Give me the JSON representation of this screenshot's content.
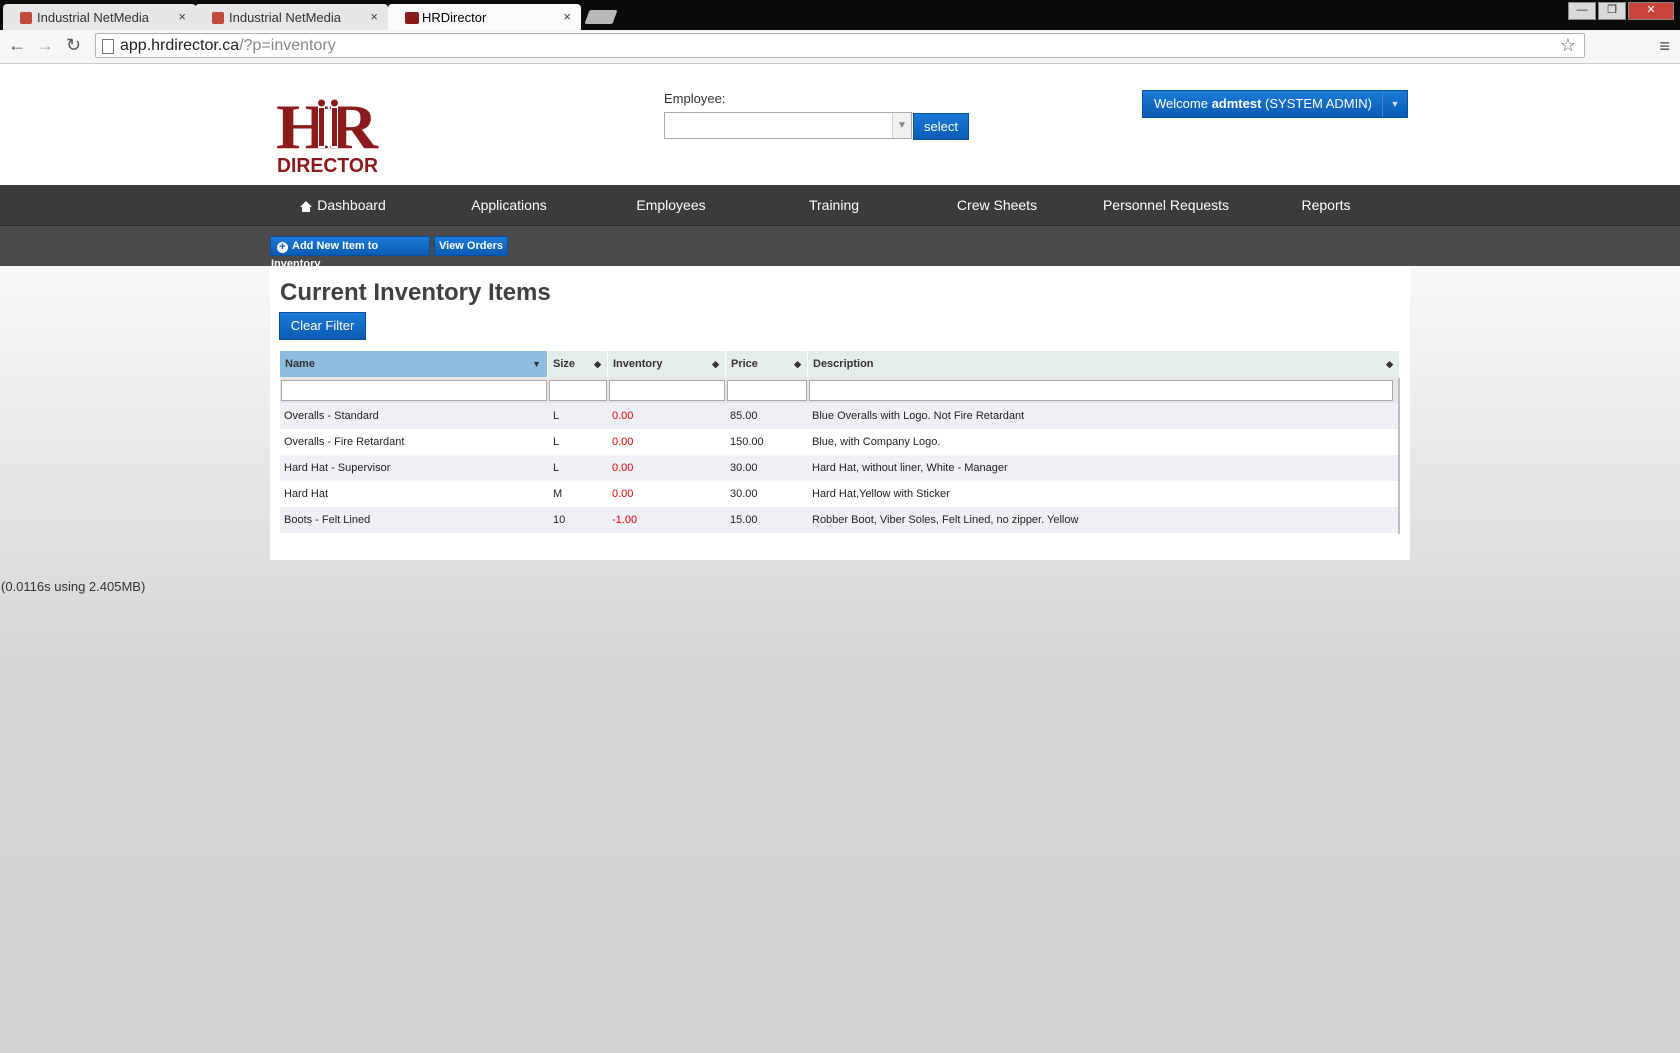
{
  "browser": {
    "tabs": [
      {
        "title": "Industrial NetMedia",
        "active": false
      },
      {
        "title": "Industrial NetMedia",
        "active": false
      },
      {
        "title": "HRDirector",
        "active": true
      }
    ],
    "close_glyph": "×",
    "url_host": "app.hrdirector.ca",
    "url_path": "/?p=inventory",
    "window_controls": [
      "—",
      "❐",
      "✕"
    ]
  },
  "header": {
    "logo_text_top": "HR",
    "logo_text_bottom": "DIRECTOR",
    "employee_label": "Employee:",
    "employee_value": "",
    "select_label": "select",
    "welcome_prefix": "Welcome ",
    "welcome_user": "admtest",
    "welcome_role": " (SYSTEM ADMIN)"
  },
  "nav": {
    "items": [
      "Dashboard",
      "Applications",
      "Employees",
      "Training",
      "Crew Sheets",
      "Personnel Requests",
      "Reports"
    ]
  },
  "subnav": {
    "add_label": "Add New Item to Inventory",
    "orders_label": "View Orders"
  },
  "main": {
    "title": "Current Inventory Items",
    "clear_filter_label": "Clear Filter",
    "columns": [
      "Name",
      "Size",
      "Inventory",
      "Price",
      "Description"
    ],
    "rows": [
      {
        "name": "Overalls - Standard",
        "size": "L",
        "inventory": "0.00",
        "price": "85.00",
        "description": "Blue Overalls with Logo. Not Fire Retardant"
      },
      {
        "name": "Overalls - Fire Retardant",
        "size": "L",
        "inventory": "0.00",
        "price": "150.00",
        "description": "Blue, with Company Logo."
      },
      {
        "name": "Hard Hat - Supervisor",
        "size": "L",
        "inventory": "0.00",
        "price": "30.00",
        "description": "Hard Hat, without liner, White - Manager"
      },
      {
        "name": "Hard Hat",
        "size": "M",
        "inventory": "0.00",
        "price": "30.00",
        "description": "Hard Hat,Yellow with Sticker"
      },
      {
        "name": "Boots - Felt Lined",
        "size": "10",
        "inventory": "-1.00",
        "price": "15.00",
        "description": "Robber Boot, Viber Soles, Felt Lined, no zipper. Yellow"
      }
    ]
  },
  "footer": {
    "stat": "(0.0116s using 2.405MB)"
  },
  "colors": {
    "brand_red": "#8b1a1a",
    "primary_blue": "#0a5bb3",
    "nav_dark": "#3b3b3b",
    "negative": "#e00000"
  }
}
